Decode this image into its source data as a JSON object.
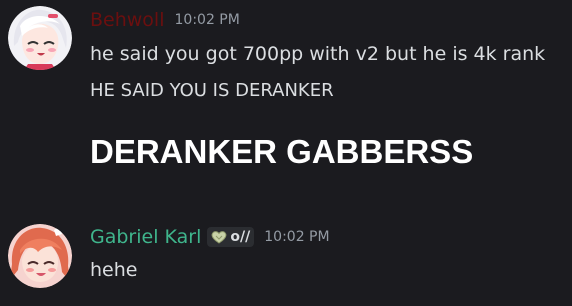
{
  "messages": [
    {
      "username": "Behwoll",
      "username_color": "#6b0f0f",
      "timestamp": "10:02 PM",
      "avatar": "anime-girl-white-hair-avatar",
      "lines": [
        "he said you got 700pp with v2 but he is 4k rank",
        "HE SAID YOU IS DERANKER",
        "DERANKER GABBERSS"
      ]
    },
    {
      "username": "Gabriel Karl",
      "username_color": "#3fb58c",
      "timestamp": "10:02 PM",
      "avatar": "anime-girl-pink-hair-avatar",
      "tag": {
        "icon": "heart-emblem-icon",
        "label": "o//"
      },
      "lines": [
        "hehe"
      ]
    }
  ],
  "colors": {
    "background": "#1b1b1f",
    "text": "#dbdee1",
    "muted": "#949ba4"
  }
}
